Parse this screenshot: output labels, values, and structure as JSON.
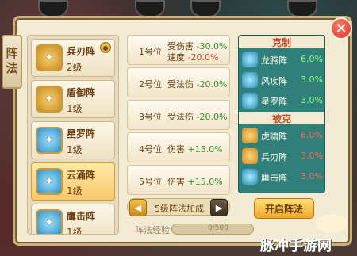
{
  "dialog": {
    "tab_label": "阵法",
    "close_symbol": "✕"
  },
  "formations": [
    {
      "name": "兵刃阵",
      "level": "2级",
      "icon": "sword-formation-icon",
      "style": "gold",
      "active": false,
      "badge": true
    },
    {
      "name": "盾御阵",
      "level": "1级",
      "icon": "shield-formation-icon",
      "style": "gold",
      "active": false,
      "badge": false
    },
    {
      "name": "星罗阵",
      "level": "1级",
      "icon": "star-formation-icon",
      "style": "blue",
      "active": false,
      "badge": false
    },
    {
      "name": "云涌阵",
      "level": "1级",
      "icon": "cloud-formation-icon",
      "style": "blue",
      "active": true,
      "badge": false
    },
    {
      "name": "鹰击阵",
      "level": "1级",
      "icon": "eagle-formation-icon",
      "style": "blue",
      "active": false,
      "badge": false
    }
  ],
  "positions": [
    {
      "label": "1号位",
      "effects": [
        {
          "text": "受伤害",
          "value": "-30.0%",
          "color": "green"
        },
        {
          "text": "速度",
          "value": "-20.0%",
          "color": "red"
        }
      ]
    },
    {
      "label": "2号位",
      "effects": [
        {
          "text": "受法伤",
          "value": "-20.0%",
          "color": "green"
        }
      ]
    },
    {
      "label": "3号位",
      "effects": [
        {
          "text": "受法伤",
          "value": "-20.0%",
          "color": "green"
        }
      ]
    },
    {
      "label": "4号位",
      "effects": [
        {
          "text": "伤害",
          "value": "+15.0%",
          "color": "green"
        }
      ]
    },
    {
      "label": "5号位",
      "effects": [
        {
          "text": "伤害",
          "value": "+15.0%",
          "color": "green"
        }
      ]
    }
  ],
  "bonus": {
    "label": "5级阵法加成",
    "prev_symbol": "◀",
    "next_symbol": "▶"
  },
  "experience": {
    "label": "阵法经验",
    "value": "0/500",
    "progress": 0
  },
  "relations": {
    "restrain_title": "克制",
    "restrain": [
      {
        "name": "龙腾阵",
        "value": "6.0%",
        "tone": "g",
        "style": "blue"
      },
      {
        "name": "风疾阵",
        "value": "3.0%",
        "tone": "g",
        "style": "blue"
      },
      {
        "name": "星罗阵",
        "value": "3.0%",
        "tone": "g",
        "style": "blue"
      }
    ],
    "restrained_title": "被克",
    "restrained": [
      {
        "name": "虎啸阵",
        "value": "6.0%",
        "tone": "r",
        "style": "gold"
      },
      {
        "name": "兵刃阵",
        "value": "3.0%",
        "tone": "r",
        "style": "gold"
      },
      {
        "name": "鹰击阵",
        "value": "3.0%",
        "tone": "r",
        "style": "blue"
      }
    ]
  },
  "open_button_label": "开启阵法",
  "watermark": "脉冲手游网",
  "colors": {
    "green": "#2f8f2a",
    "red": "#d23a2a",
    "accent": "#f0a829"
  }
}
